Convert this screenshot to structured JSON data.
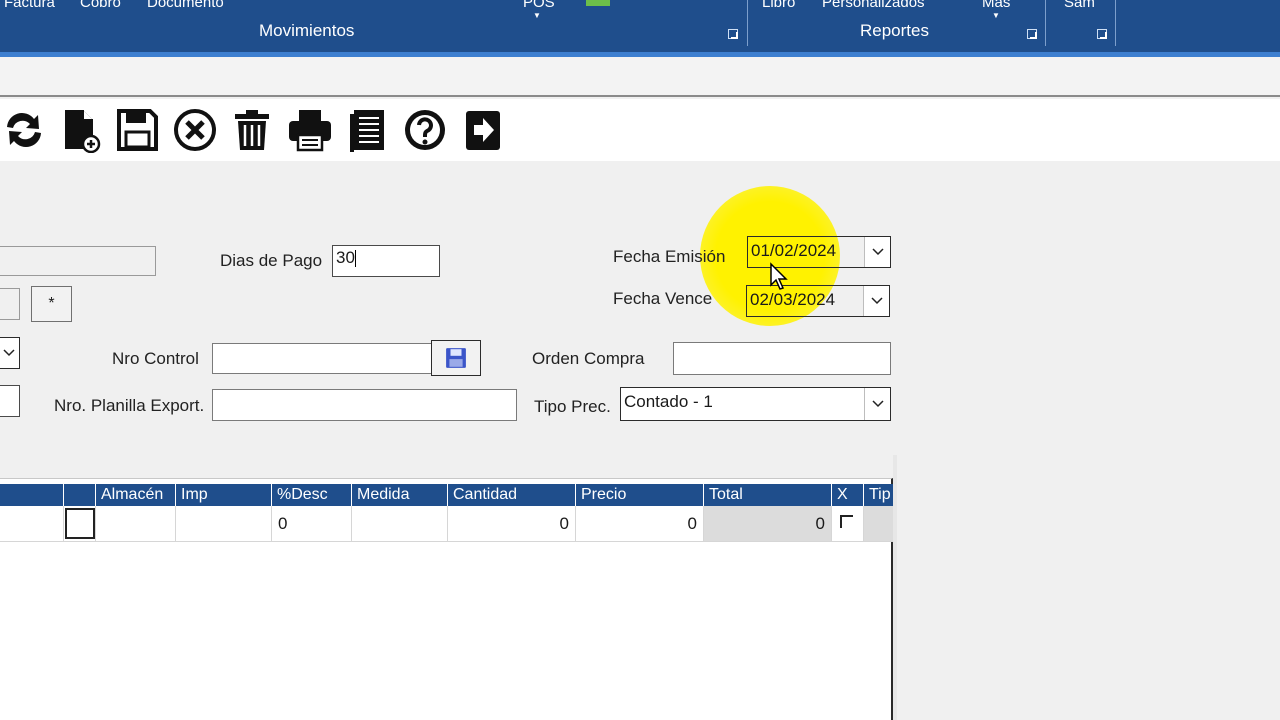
{
  "ribbon": {
    "top_items": [
      "Factura",
      "Cobro",
      "Documento",
      "POS",
      "Libro",
      "Personalizados",
      "Mas",
      "Sam"
    ],
    "groups": [
      "Movimientos",
      "Reportes"
    ]
  },
  "toolbar": {
    "buttons": [
      "refresh-icon",
      "new-document-icon",
      "save-icon",
      "cancel-icon",
      "delete-icon",
      "print-icon",
      "report-icon",
      "help-icon",
      "exit-icon"
    ]
  },
  "form": {
    "dias_pago_label": "Dias de Pago",
    "dias_pago_value": "30",
    "asterisk_button": "*",
    "nro_control_label": "Nro Control",
    "nro_control_value": "",
    "planilla_label": "Nro. Planilla Export.",
    "planilla_value": "",
    "fecha_emision_label": "Fecha Emisión",
    "fecha_emision_value": "01/02/2024",
    "fecha_vence_label": "Fecha Vence",
    "fecha_vence_value": "02/03/2024",
    "orden_compra_label": "Orden Compra",
    "orden_compra_value": "",
    "tipo_prec_label": "Tipo Prec.",
    "tipo_prec_value": "Contado - 1"
  },
  "grid": {
    "columns": [
      "",
      "Almacén",
      "Imp",
      "%Desc",
      "Medida",
      "Cantidad",
      "Precio",
      "Total",
      "X",
      "Tip"
    ],
    "row": {
      "desc": "0",
      "cantidad": "0",
      "precio": "0",
      "total": "0"
    }
  },
  "colors": {
    "ribbon": "#1f4e8c",
    "highlight": "#fff200"
  }
}
